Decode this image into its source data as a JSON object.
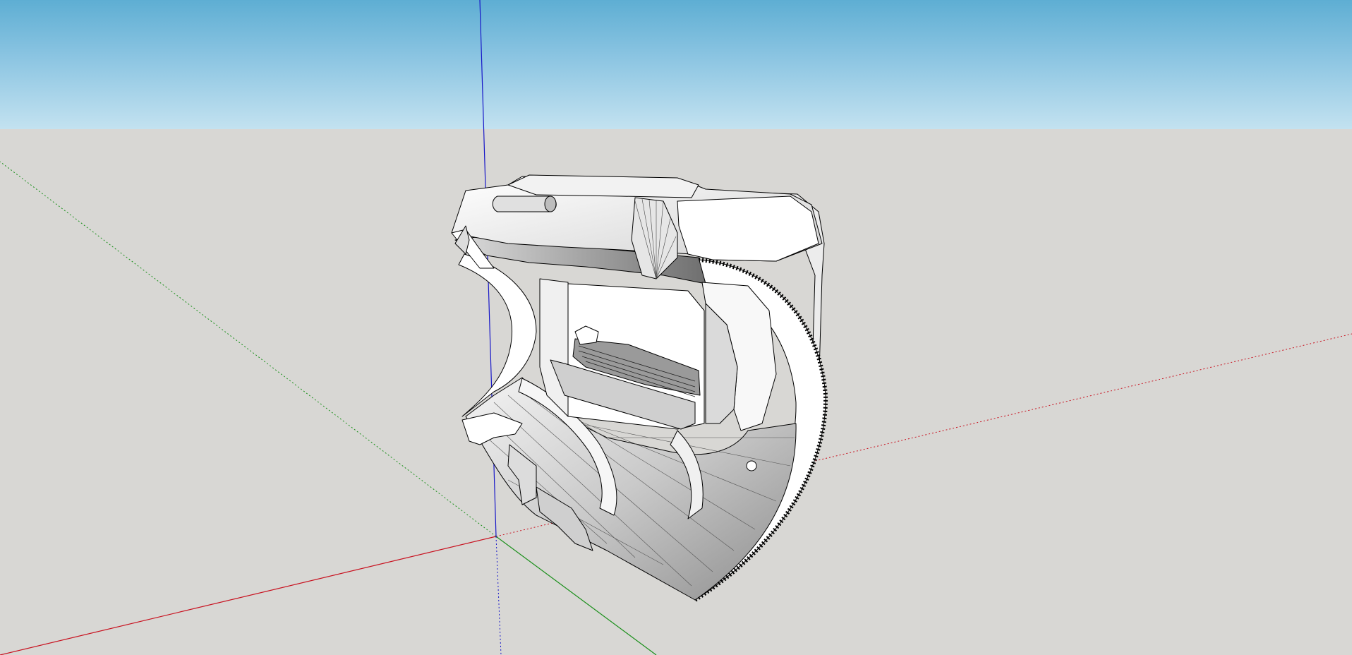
{
  "viewport": {
    "sky_color_top": "#5eaed3",
    "sky_color_bottom": "#c3e2f0",
    "ground_color": "#d8d7d4"
  },
  "axes": {
    "red_axis_color": "#c8101e",
    "green_axis_color": "#1a8f1a",
    "blue_axis_color": "#1717c8"
  },
  "model": {
    "face_color": "#ffffff",
    "shade_color": "#9a9a9a",
    "edge_color": "#000000"
  }
}
